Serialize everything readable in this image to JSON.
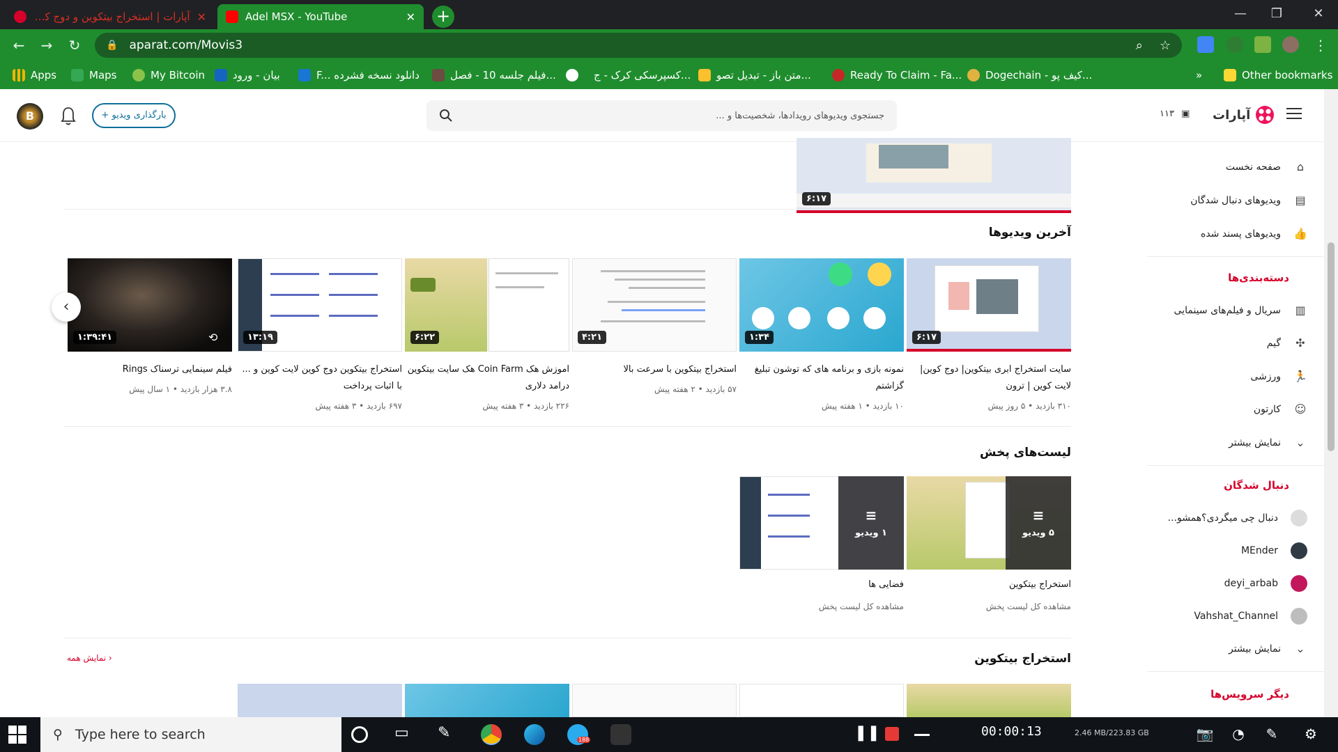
{
  "browser": {
    "tabs": [
      {
        "title": "آپارات | استخراج بیتکوین و دوج کو..",
        "active": false
      },
      {
        "title": "Adel MSX - YouTube",
        "active": true
      }
    ],
    "url": "aparat.com/Movis3",
    "bookmarks": [
      {
        "label": "Apps",
        "icon": "apps-grid-icon"
      },
      {
        "label": "Maps",
        "icon": "maps-icon"
      },
      {
        "label": "My Bitcoin",
        "icon": "bitcoin-icon"
      },
      {
        "label": "بیان - ورود",
        "icon": "bayan-icon"
      },
      {
        "label": "F... دانلود نسخه فشرده",
        "icon": "download-icon"
      },
      {
        "label": "فیلم جلسه 10 - فصل...",
        "icon": "film-icon"
      },
      {
        "label": "",
        "icon": "google-icon"
      },
      {
        "label": "کسپرسکی کرک - ج...",
        "icon": "kaspersky-icon"
      },
      {
        "label": "متن باز - تبدیل تصو...",
        "icon": "text-icon"
      },
      {
        "label": "Ready To Claim - Fa...",
        "icon": "claim-icon"
      },
      {
        "label": "Dogechain - کیف پو...",
        "icon": "dogechain-icon"
      }
    ],
    "bookmarks_overflow": "»",
    "other_bookmarks": "Other bookmarks"
  },
  "header": {
    "upload_label": "+ بارگذاری ویدیو",
    "search_placeholder": "جستجوی ویدیوهای رویدادها، شخصیت‌ها و ...",
    "count": "۱۱۳",
    "logo": "آپارات",
    "avatar_letter": "B"
  },
  "sidebar": {
    "main_items": [
      {
        "label": "صفحه نخست",
        "icon": "home-icon"
      },
      {
        "label": "ویدیوهای دنبال شدگان",
        "icon": "subscriptions-icon"
      },
      {
        "label": "ویدیوهای پسند شده",
        "icon": "like-icon"
      }
    ],
    "categories_title": "دسته‌بندی‌ها",
    "categories": [
      {
        "label": "سریال و فیلم‌های سینمایی",
        "icon": "film-strip-icon"
      },
      {
        "label": "گیم",
        "icon": "game-icon"
      },
      {
        "label": "ورزشی",
        "icon": "sport-icon"
      },
      {
        "label": "کارتون",
        "icon": "cartoon-icon"
      },
      {
        "label": "نمایش بیشتر",
        "icon": "chevron-down-icon"
      }
    ],
    "following_title": "دنبال شدگان",
    "following": [
      {
        "label": "دنبال چی میگردی؟همشو...",
        "color": "#dcdcdc"
      },
      {
        "label": "MEnder",
        "color": "#2f3a44"
      },
      {
        "label": "deyi_arbab",
        "color": "#c2185b"
      },
      {
        "label": "Vahshat_Channel",
        "color": "#bdbdbd"
      },
      {
        "label": "نمایش بیشتر",
        "color": ""
      }
    ],
    "other_services_title": "دیگر سرویس‌ها"
  },
  "main": {
    "hero_duration": "۶:۱۷",
    "latest_title": "آخرین ویدیوها",
    "videos": [
      {
        "title": "سایت استخراج ابری بیتکوین| دوج کوین| لایت کوین | ترون",
        "views": "۳۱۰ بازدید",
        "age": "۵ روز پیش",
        "duration": "۶:۱۷"
      },
      {
        "title": "نمونه بازی و برنامه های که توشون تبلیغ گزاشتم",
        "views": "۱۰ بازدید",
        "age": "۱ هفته پیش",
        "duration": "۱:۳۴"
      },
      {
        "title": "استخراج بیتکوین با سرعت بالا",
        "views": "۵۷ بازدید",
        "age": "۲ هفته پیش",
        "duration": "۴:۲۱"
      },
      {
        "title": "اموزش هک Coin Farm هک سایت بیتکوین درامد دلاری",
        "views": "۲۲۶ بازدید",
        "age": "۳ هفته پیش",
        "duration": "۶:۲۲"
      },
      {
        "title": "استخراج بیتکوین دوج کوین لایت کوین و ... با اثبات پرداخت",
        "views": "۶۹۷ بازدید",
        "age": "۳ هفته پیش",
        "duration": "۱۳:۱۹"
      },
      {
        "title": "فیلم سینمایی ترسناک Rings",
        "views": "۳.۸ هزار بازدید",
        "age": "۱ سال پیش",
        "duration": "۱:۳۹:۴۱"
      }
    ],
    "playlists_title": "لیست‌های پخش",
    "playlists": [
      {
        "title": "استخراج بیتکوین",
        "count": "۵ ویدیو",
        "link": "مشاهده کل لیست پخش"
      },
      {
        "title": "فضایی ها",
        "count": "۱ ویدیو",
        "link": "مشاهده کل لیست پخش"
      }
    ],
    "bitcoin_section_title": "استخراج بیتکوین",
    "show_all": "نمایش همه"
  },
  "taskbar": {
    "search_placeholder": "Type here to search",
    "telegram_badge": "188",
    "timer": "00:00:13",
    "memory": "2.46 MB/223.83 GB"
  },
  "colors": {
    "chrome_green": "#1f8d2e",
    "aparat_red": "#d6002a",
    "upload_blue": "#0d6e9b"
  }
}
